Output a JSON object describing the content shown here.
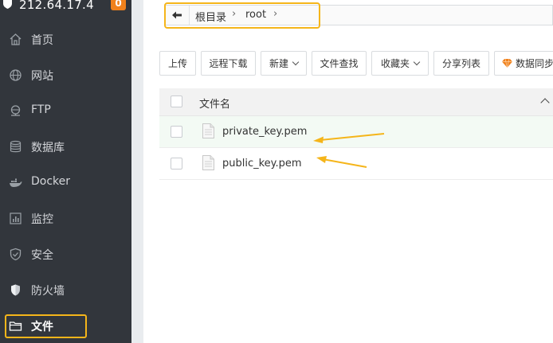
{
  "sidebar": {
    "server_ip": "212.64.17.4",
    "badge": "0",
    "items": [
      {
        "label": "首页",
        "icon": "home-icon"
      },
      {
        "label": "网站",
        "icon": "globe-icon"
      },
      {
        "label": "FTP",
        "icon": "ftp-icon"
      },
      {
        "label": "数据库",
        "icon": "database-icon"
      },
      {
        "label": "Docker",
        "icon": "docker-icon"
      },
      {
        "label": "监控",
        "icon": "monitor-icon"
      },
      {
        "label": "安全",
        "icon": "shield-check-icon"
      },
      {
        "label": "防火墙",
        "icon": "firewall-icon"
      },
      {
        "label": "文件",
        "icon": "folder-icon"
      }
    ]
  },
  "path": {
    "root_label": "根目录",
    "current": "root"
  },
  "toolbar": {
    "upload": "上传",
    "remote_download": "远程下载",
    "new": "新建",
    "file_search": "文件查找",
    "favorites": "收藏夹",
    "share_list": "分享列表",
    "data_sync": "数据同步"
  },
  "table": {
    "header_name": "文件名",
    "rows": [
      {
        "name": "private_key.pem"
      },
      {
        "name": "public_key.pem"
      }
    ]
  },
  "colors": {
    "sidebar_bg": "#32363c",
    "highlight": "#f5b51a",
    "badge": "#f0811c",
    "arrow": "#f5b51a"
  }
}
